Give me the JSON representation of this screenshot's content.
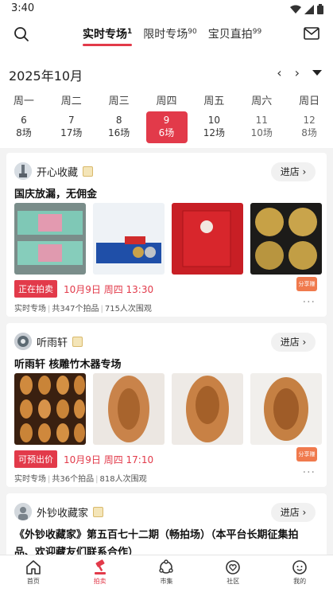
{
  "status_bar": {
    "time": "3:40"
  },
  "header": {
    "tabs": [
      {
        "label": "实时专场",
        "sup": "1",
        "active": true
      },
      {
        "label": "限时专场",
        "sup": "90",
        "active": false
      },
      {
        "label": "宝贝直拍",
        "sup": "99",
        "active": false
      }
    ]
  },
  "calendar": {
    "title": "2025年10月",
    "prev": "‹",
    "next": "›",
    "days": [
      {
        "weekday": "周一",
        "date": "6",
        "count": "8场"
      },
      {
        "weekday": "周二",
        "date": "7",
        "count": "17场"
      },
      {
        "weekday": "周三",
        "date": "8",
        "count": "16场"
      },
      {
        "weekday": "周四",
        "date": "9",
        "count": "6场",
        "selected": true
      },
      {
        "weekday": "周五",
        "date": "10",
        "count": "12场"
      },
      {
        "weekday": "周六",
        "date": "11",
        "count": "10场"
      },
      {
        "weekday": "周日",
        "date": "12",
        "count": "8场"
      }
    ]
  },
  "cards": [
    {
      "shop_name": "开心收藏",
      "enter_label": "进店 ›",
      "title": "国庆放漏，无佣金",
      "status_tag": "正在拍卖",
      "time": "10月9日 周四 13:30",
      "share_label": "分享赚钱",
      "meta": {
        "type": "实时专场",
        "lots": "共347个拍品",
        "views": "715人次围观"
      },
      "more": "···"
    },
    {
      "shop_name": "听雨轩",
      "enter_label": "进店 ›",
      "title": "听雨轩 核雕竹木器专场",
      "status_tag": "可预出价",
      "time": "10月9日 周四 17:10",
      "share_label": "分享赚钱",
      "meta": {
        "type": "实时专场",
        "lots": "共36个拍品",
        "views": "818人次围观"
      },
      "more": "···"
    },
    {
      "shop_name": "外钞收藏家",
      "enter_label": "进店 ›",
      "title": "《外钞收藏家》第五百七十二期（畅拍场）（本平台长期征集拍品、欢迎藏友们联系合作）"
    }
  ],
  "bottom_nav": [
    {
      "label": "首页",
      "icon": "home-icon",
      "active": false
    },
    {
      "label": "拍卖",
      "icon": "gavel-icon",
      "active": true
    },
    {
      "label": "市集",
      "icon": "market-icon",
      "active": false
    },
    {
      "label": "社区",
      "icon": "community-icon",
      "active": false
    },
    {
      "label": "我的",
      "icon": "profile-icon",
      "active": false
    }
  ],
  "colors": {
    "accent": "#e23a4a",
    "share": "#f07a4d"
  }
}
